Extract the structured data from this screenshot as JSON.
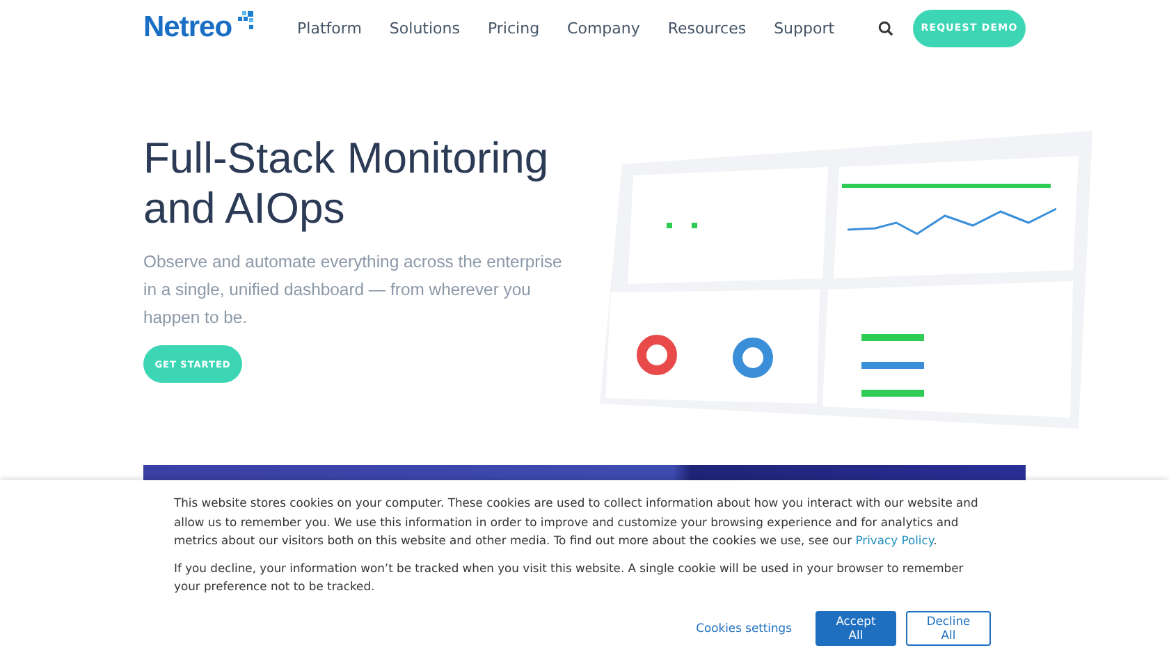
{
  "header": {
    "logo": "Netreo",
    "nav": [
      {
        "label": "Platform"
      },
      {
        "label": "Solutions"
      },
      {
        "label": "Pricing"
      },
      {
        "label": "Company"
      },
      {
        "label": "Resources"
      },
      {
        "label": "Support"
      }
    ],
    "cta": "REQUEST DEMO"
  },
  "hero": {
    "title": "Full-Stack Monitoring and AIOps",
    "subtitle": "Observe and automate everything across the enterprise in a single, unified dashboard — from wherever you happen to be.",
    "button": "GET STARTED"
  },
  "cookie_banner": {
    "paragraphs": [
      {
        "text": "This website stores cookies on your computer. These cookies are used to collect information about how you interact with our website and allow us to remember you. We use this information in order to improve and customize your browsing experience and for analytics and metrics about our visitors both on this website and other media. To find out more about the cookies we use, see our ",
        "link": "Privacy Policy",
        "after": "."
      },
      {
        "text": "If you decline, your information won’t be tracked when you visit this website. A single cookie will be used in your browser to remember your preference not to be tracked."
      }
    ],
    "buttons": [
      {
        "label": "Cookies settings",
        "kind": "link"
      },
      {
        "label": "Accept All",
        "kind": "primary"
      },
      {
        "label": "Decline All",
        "kind": "outline"
      }
    ]
  }
}
